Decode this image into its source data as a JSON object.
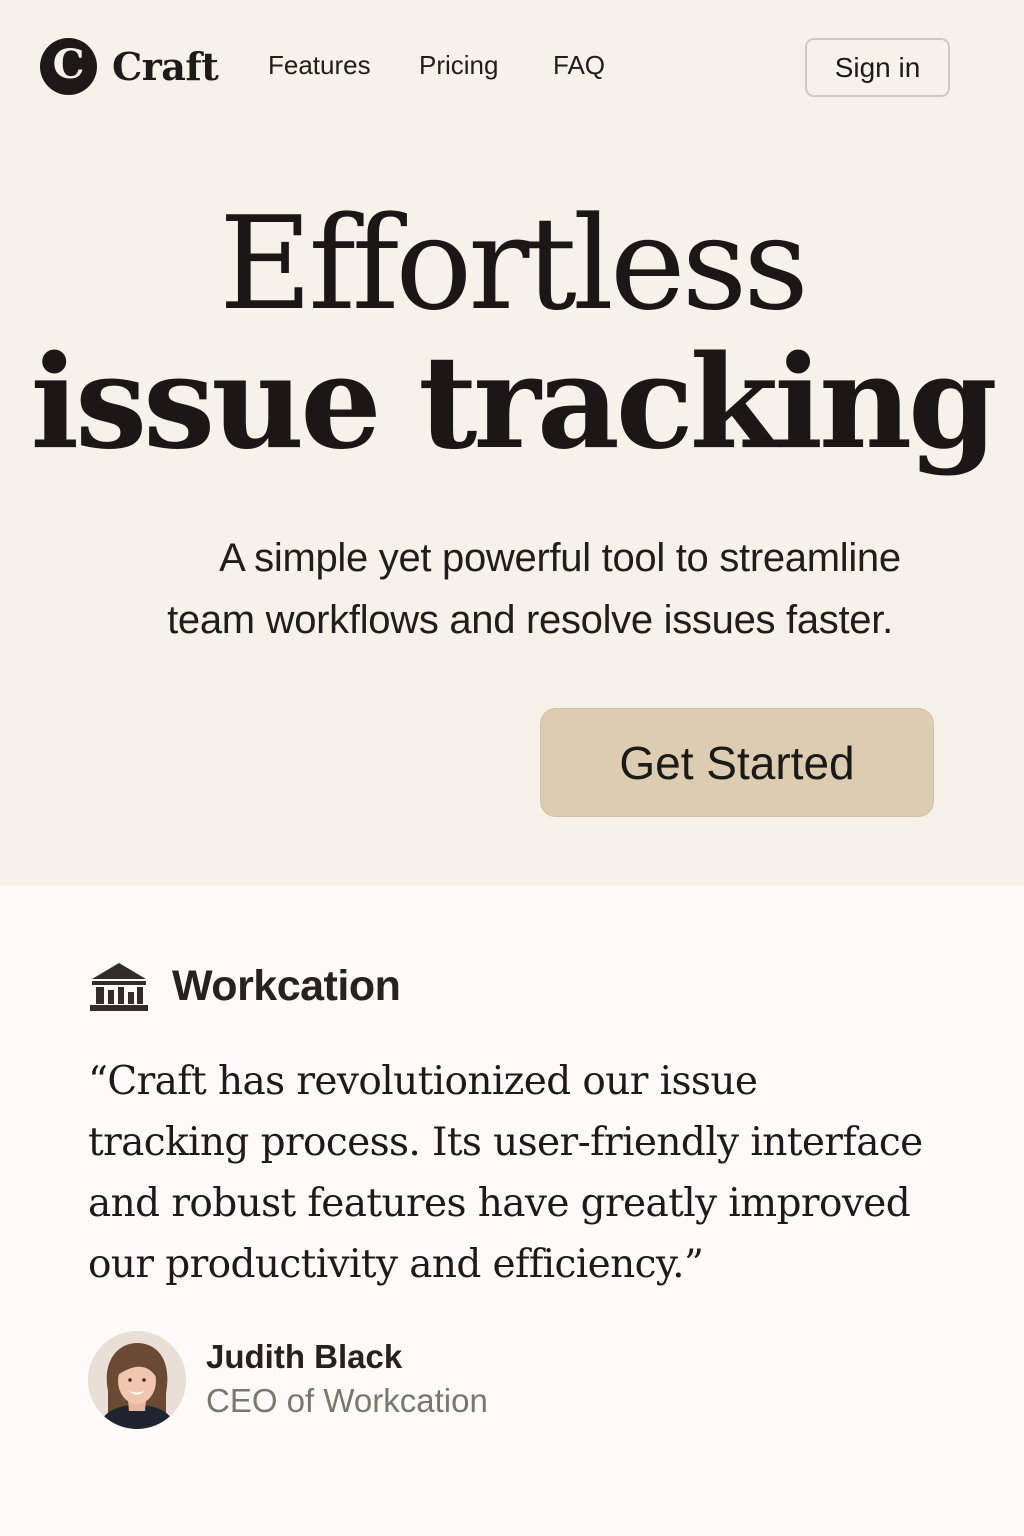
{
  "nav": {
    "logo_letter": "C",
    "logo_text": "Craft",
    "links": [
      "Features",
      "Pricing",
      "FAQ"
    ],
    "signin_label": "Sign in"
  },
  "hero": {
    "headline_line1": "Effortless",
    "headline_line2": "issue tracking",
    "subhead_line1": "A simple yet powerful tool to streamline",
    "subhead_line2": "team workflows and resolve issues faster.",
    "cta_label": "Get Started"
  },
  "testimonial": {
    "company_name": "Workcation",
    "company_icon": "building-columns-icon",
    "quote_lines": [
      "“Craft has revolutionized our issue",
      "tracking process. Its user-friendly interface",
      "and robust features have greatly improved",
      "our productivity and efficiency.”"
    ],
    "author_name": "Judith Black",
    "author_title": "CEO of Workcation"
  },
  "colors": {
    "hero_background": "#f6f2ea",
    "page_background": "#fcfbf8",
    "cta_background": "#dccdb2",
    "text": "#1c1b19",
    "muted_text": "#7b766e"
  }
}
